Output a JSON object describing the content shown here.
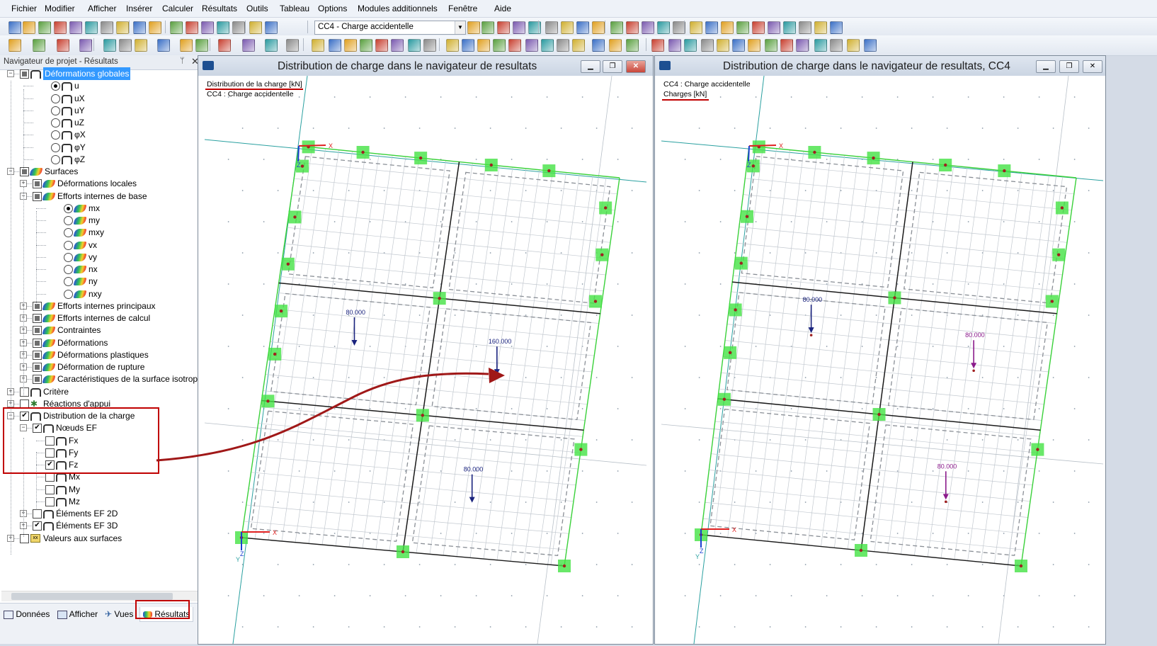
{
  "menu": [
    "Fichier",
    "Modifier",
    "Afficher",
    "Insérer",
    "Calculer",
    "Résultats",
    "Outils",
    "Tableau",
    "Options",
    "Modules additionnels",
    "Fenêtre",
    "Aide"
  ],
  "toolbar": {
    "loadcase": "CC4 - Charge accidentelle"
  },
  "navigator": {
    "title": "Navigateur de projet - Résultats",
    "pin_icon": "pin-icon",
    "items": {
      "deformations_globales": "Déformations globales",
      "u": "u",
      "ux": "uX",
      "uy": "uY",
      "uz": "uZ",
      "phix": "φX",
      "phiy": "φY",
      "phiz": "φZ",
      "surfaces": "Surfaces",
      "def_locales": "Déformations locales",
      "efforts_base": "Efforts internes de base",
      "mx": "mx",
      "my": "my",
      "mxy": "mxy",
      "vx": "vx",
      "vy": "vy",
      "nx": "nx",
      "ny": "ny",
      "nxy": "nxy",
      "efforts_principaux": "Efforts internes principaux",
      "efforts_calcul": "Efforts internes de calcul",
      "contraintes": "Contraintes",
      "deformations": "Déformations",
      "def_plastiques": "Déformations plastiques",
      "def_rupture": "Déformation de rupture",
      "carac_surface": "Caractéristiques de la surface isotrope",
      "critere": "Critère",
      "reactions": "Réactions d'appui",
      "distribution": "Distribution de la charge",
      "noeuds_ef": "Nœuds EF",
      "fx": "Fx",
      "fy": "Fy",
      "fz": "Fz",
      "mx_n": "Mx",
      "my_n": "My",
      "mz_n": "Mz",
      "elements_2d": "Éléments EF 2D",
      "elements_3d": "Éléments EF 3D",
      "valeurs_surfaces": "Valeurs aux surfaces"
    },
    "tabs": [
      "Données",
      "Afficher",
      "Vues",
      "Résultats"
    ]
  },
  "window_left": {
    "title": "Distribution de charge dans le navigateur de resultats",
    "info_line1": "Distribution de la charge [kN]",
    "info_line2": "CC4 : Charge accidentelle",
    "loads": [
      "80.000",
      "160.000",
      "80.000"
    ],
    "axes": {
      "x": "X",
      "z": "Z",
      "y": "Y"
    }
  },
  "window_right": {
    "title": "Distribution de charge dans le navigateur de resultats, CC4",
    "info_line1": "CC4 : Charge accidentelle",
    "info_line2": "Charges [kN]",
    "loads": [
      "80.000",
      "80.000",
      "80.000"
    ],
    "axes": {
      "x": "X",
      "z": "Z",
      "y": "Y"
    }
  },
  "colors": {
    "selection": "#3399ff",
    "annotation_red": "#c00000",
    "support_green": "#44e244",
    "load_blue": "#1a237e",
    "load_purple": "#8b1a8b"
  }
}
